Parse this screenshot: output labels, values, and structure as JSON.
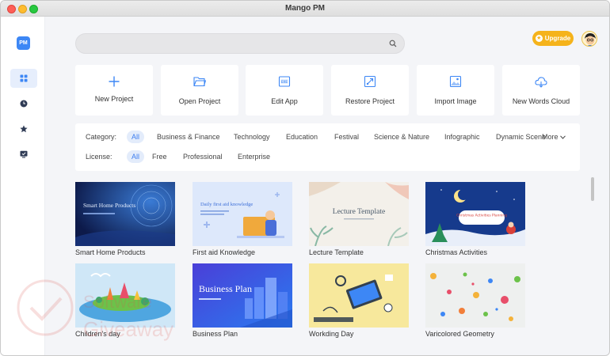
{
  "window": {
    "title": "Mango PM"
  },
  "sidebar": {
    "logo": "PM",
    "items": [
      {
        "name": "grid-icon",
        "active": true
      },
      {
        "name": "clock-icon",
        "active": false
      },
      {
        "name": "star-icon",
        "active": false
      },
      {
        "name": "monitor-check-icon",
        "active": false
      }
    ]
  },
  "search": {
    "placeholder": "",
    "value": ""
  },
  "header": {
    "upgrade_label": "Upgrade"
  },
  "actions": [
    {
      "label": "New Project",
      "icon": "plus-icon"
    },
    {
      "label": "Open Project",
      "icon": "folder-open-icon"
    },
    {
      "label": "Edit App",
      "icon": "exe-file-icon"
    },
    {
      "label": "Restore Project",
      "icon": "restore-icon"
    },
    {
      "label": "Import Image",
      "icon": "image-icon"
    },
    {
      "label": "New Words Cloud",
      "icon": "cloud-icon"
    }
  ],
  "filters": {
    "category_label": "Category:",
    "categories": [
      "All",
      "Business & Finance",
      "Technology",
      "Education",
      "Festival",
      "Science & Nature",
      "Infographic",
      "Dynamic Scene"
    ],
    "more_label": "More",
    "license_label": "License:",
    "licenses": [
      "All",
      "Free",
      "Professional",
      "Enterprise"
    ]
  },
  "templates": [
    {
      "caption": "Smart Home Products",
      "thumb_title": "Smart Home Products"
    },
    {
      "caption": "First aid Knowledge",
      "thumb_title": "Daily first aid knowledge"
    },
    {
      "caption": "Lecture Template",
      "thumb_title": "Lecture Template"
    },
    {
      "caption": "Christmas Activities",
      "thumb_title": "Christmas Activities Planning"
    },
    {
      "caption": "Children's day",
      "thumb_title": ""
    },
    {
      "caption": "Business Plan",
      "thumb_title": "Business Plan"
    },
    {
      "caption": "Workding Day",
      "thumb_title": ""
    },
    {
      "caption": "Varicolored Geometry",
      "thumb_title": ""
    }
  ],
  "watermark": {
    "line1": "Software",
    "line2": "Giveaway"
  },
  "colors": {
    "accent": "#3d87f5",
    "upgrade": "#f5b31b",
    "chip_active_bg": "#e3ecfb"
  }
}
